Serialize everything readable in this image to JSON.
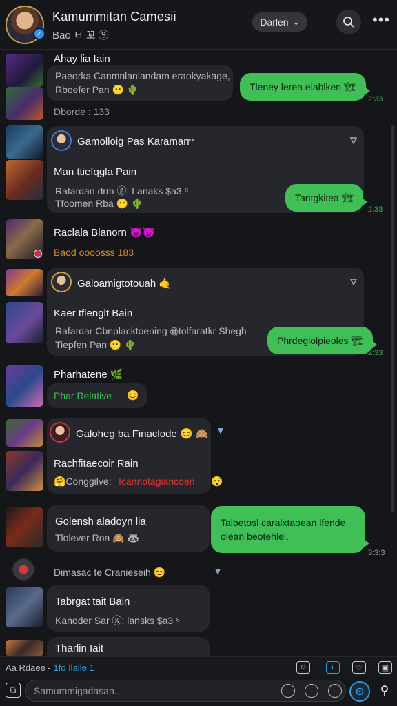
{
  "header": {
    "title": "Kamummitan Camesii",
    "subtitle": "Bao ㅂ 꼬 ⑨",
    "sort_label": "Darlen",
    "sort_chevron": "⌄",
    "more_glyph": "•••"
  },
  "threads": [
    {
      "name": "Ahay lia Iain",
      "line1": "Paeorka Canmnlanlandam eraokyakage,",
      "line2": "Rboefer Pan 😶 🌵",
      "meta": "Dborde : 133",
      "reply": "Tleney lerea elablken 🏗",
      "reply_time": "2:33"
    },
    {
      "group": "Gamolloig Pas Karaman",
      "group_suffix": "••",
      "name": "Man ttiefqgla Pain",
      "line1": "Rafardan drm ⓖ: Lanaks $a3 ⁸",
      "line2": "Tfoomen Rba 😶 🌵",
      "reply": "Tantgkitea 🏗",
      "reply_time": "2:33"
    },
    {
      "name": "Raclala Blanorn 😈😈",
      "meta": "Baod oooosss 183"
    },
    {
      "group": "Galoamigtotouah 🤙",
      "name": "Kaer tflenglt Bain",
      "line1": "Rafardar Cbnplacktoening ꙮtolfaratkr Shegh",
      "line2": "Tiepfen Pan 😶 🌵",
      "reply": "Phrdeglolpieoles 🏗",
      "reply_time": "2:33"
    },
    {
      "name": "Pharhatene 🌿",
      "status": "Phar Relative",
      "status_emoji": "😊"
    },
    {
      "group": "Galoheg ba Finaclode 😊 🙈",
      "name": "Rachfitaecoir Rain",
      "line1_prefix": "🤗Conggilve:",
      "line1_red": "Icannotagiancoen",
      "line1_emoji": "😯"
    },
    {
      "name": "Golensh aladoyn lia",
      "line1": "Tlolever Roa 🙈 🦝",
      "reply": "Talbetosl caralxtaoean lfende, olean beotehiel.",
      "reply_time": "3:3:3"
    },
    {
      "name": "Dimasac te Cranieseih 😊",
      "system": true
    },
    {
      "name": "Tabrgat tait Bain",
      "line1": "Kanoder Sar ⓖ: lansks $a3 ⁸"
    },
    {
      "name": "Tharlin Iait"
    }
  ],
  "status_bar": {
    "text_a": "Aa Rdaee -",
    "text_b": "1fo Ilalle 1"
  },
  "composer": {
    "placeholder": "Samummigadasan.."
  },
  "colors": {
    "background": "#15161a",
    "card": "#25272c",
    "accent_green": "#3fbf55",
    "accent_blue": "#2f9ee8",
    "alert_red": "#e3322f"
  }
}
